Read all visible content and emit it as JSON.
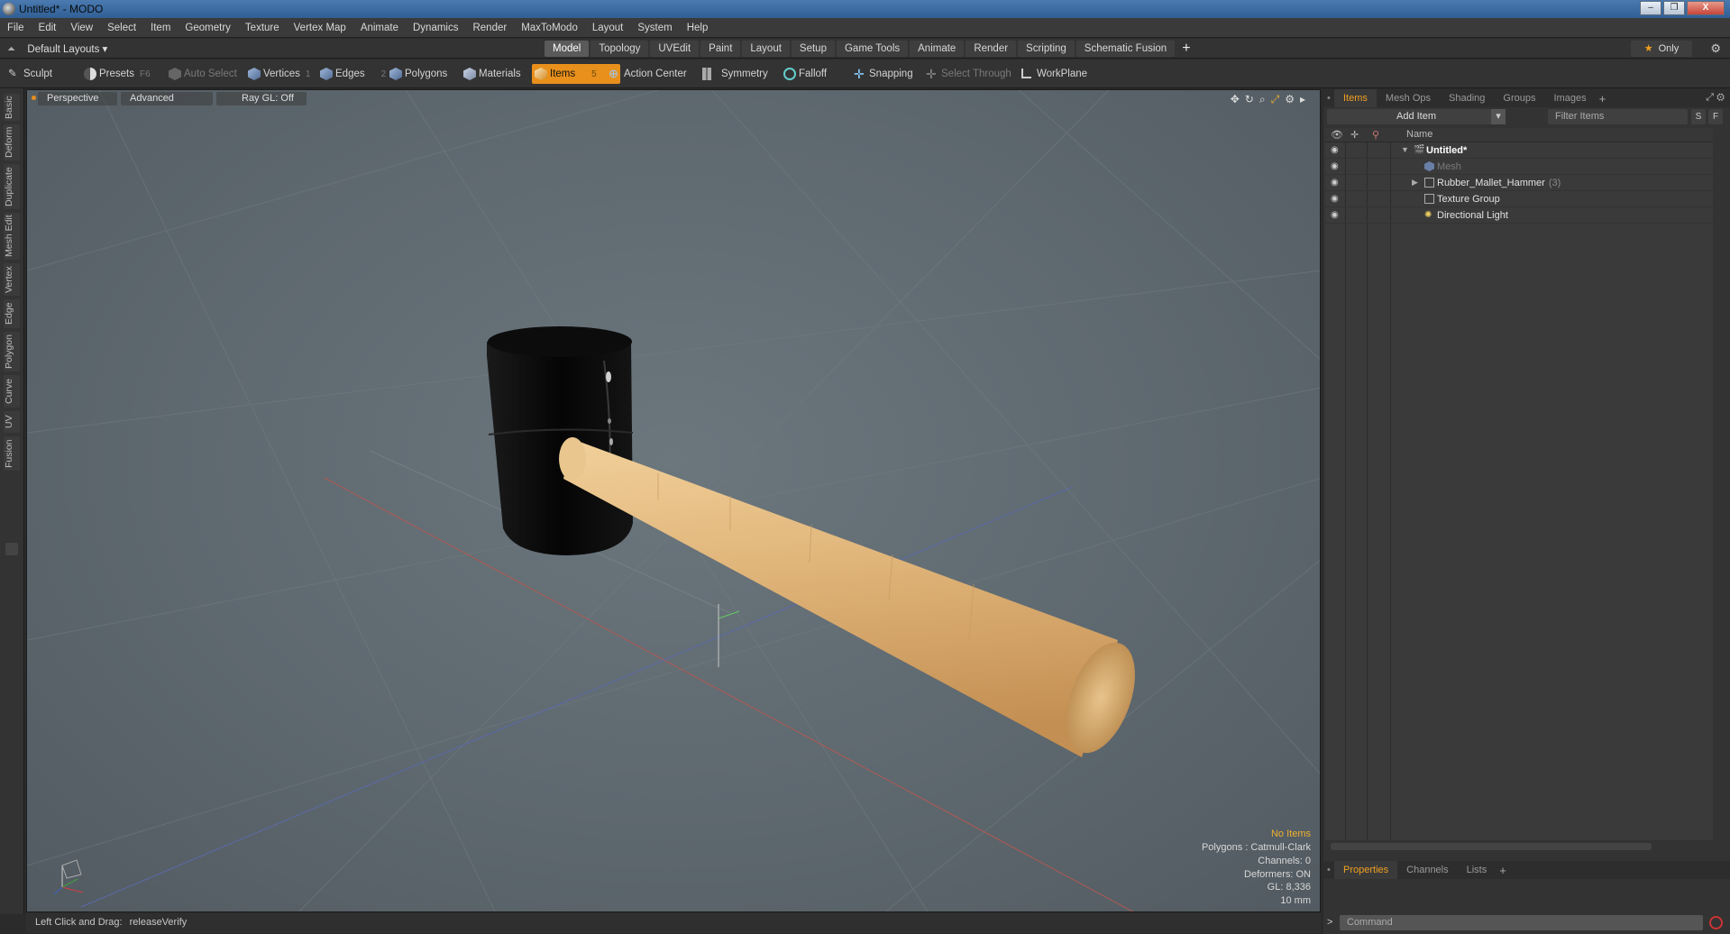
{
  "window": {
    "title": "Untitled* - MODO",
    "buttons": [
      "–",
      "❐",
      "X"
    ]
  },
  "menu": [
    "File",
    "Edit",
    "View",
    "Select",
    "Item",
    "Geometry",
    "Texture",
    "Vertex Map",
    "Animate",
    "Dynamics",
    "Render",
    "MaxToModo",
    "Layout",
    "System",
    "Help"
  ],
  "layoutbar": {
    "layout_label": "Default Layouts ▾",
    "tabs": [
      "Model",
      "Topology",
      "UVEdit",
      "Paint",
      "Layout",
      "Setup",
      "Game Tools",
      "Animate",
      "Render",
      "Scripting",
      "Schematic Fusion"
    ],
    "active_tab": "Model",
    "plus": "+",
    "only_label": "Only"
  },
  "toolbar": {
    "sculpt": "Sculpt",
    "presets": "Presets",
    "presets_key": "F6",
    "auto_select": "Auto Select",
    "vertices": "Vertices",
    "vertices_key": "1",
    "edges": "Edges",
    "edges_key": "2",
    "polygons": "Polygons",
    "materials": "Materials",
    "items": "Items",
    "items_key": "5",
    "action_center": "Action Center",
    "symmetry": "Symmetry",
    "falloff": "Falloff",
    "snapping": "Snapping",
    "select_through": "Select Through",
    "workplane": "WorkPlane"
  },
  "left_tabs": [
    "Basic",
    "Deform",
    "Duplicate",
    "Mesh Edit",
    "Vertex",
    "Edge",
    "Polygon",
    "Curve",
    "UV",
    "Fusion"
  ],
  "viewport": {
    "perspective": "Perspective",
    "advanced": "Advanced",
    "raygl": "Ray GL: Off",
    "info": {
      "no_items": "No Items",
      "polygons": "Polygons : Catmull-Clark",
      "channels": "Channels: 0",
      "deformers": "Deformers: ON",
      "gl": "GL: 8,336",
      "unit": "10 mm"
    }
  },
  "status": {
    "hint_key": "Left Click and Drag:",
    "hint_value": "releaseVerify"
  },
  "right_panel": {
    "tabs": [
      "Items",
      "Mesh Ops",
      "Shading",
      "Groups",
      "Images"
    ],
    "active_tab": "Items",
    "add_item": "Add Item",
    "filter_placeholder": "Filter Items",
    "s_btn": "S",
    "f_btn": "F",
    "column_name": "Name",
    "tree": [
      {
        "label": "Untitled*",
        "style": "bold"
      },
      {
        "label": "Mesh",
        "style": "muted"
      },
      {
        "label": "Rubber_Mallet_Hammer",
        "count": "(3)",
        "style": "normal"
      },
      {
        "label": "Texture Group",
        "style": "normal"
      },
      {
        "label": "Directional Light",
        "style": "normal"
      }
    ],
    "bottom_tabs": [
      "Properties",
      "Channels",
      "Lists"
    ],
    "bottom_active": "Properties",
    "command_placeholder": "Command",
    "prompt": ">"
  }
}
